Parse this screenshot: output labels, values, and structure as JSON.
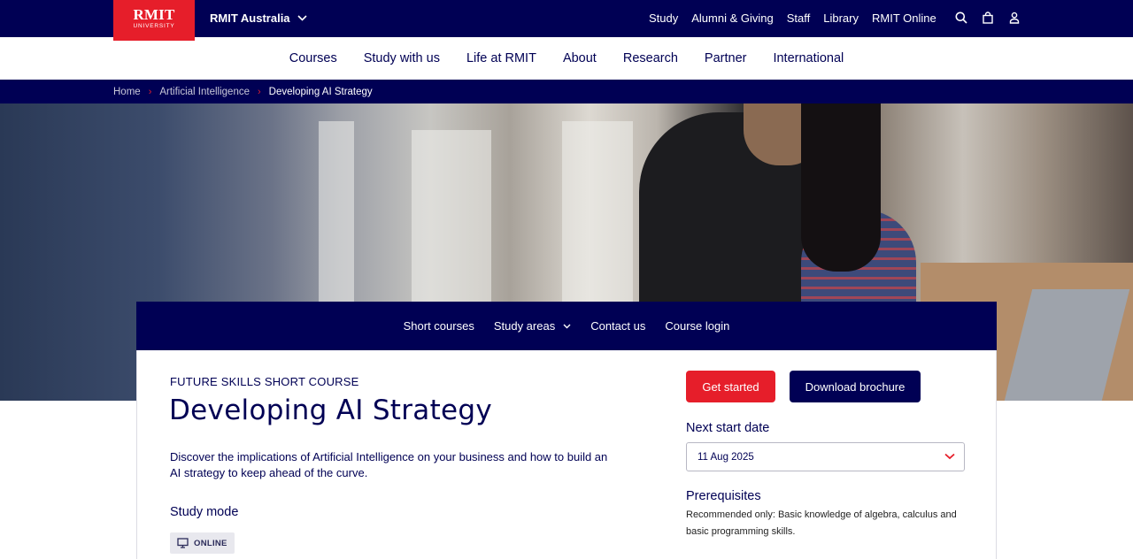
{
  "logo": {
    "mark": "RMIT",
    "sub": "UNIVERSITY"
  },
  "topbar": {
    "site_switch": "RMIT Australia",
    "links": [
      "Study",
      "Alumni & Giving",
      "Staff",
      "Library",
      "RMIT Online"
    ]
  },
  "mainnav": [
    "Courses",
    "Study with us",
    "Life at RMIT",
    "About",
    "Research",
    "Partner",
    "International"
  ],
  "breadcrumb": {
    "home": "Home",
    "parent": "Artificial Intelligence",
    "current": "Developing AI Strategy"
  },
  "subnav": {
    "short_courses": "Short courses",
    "study_areas": "Study areas",
    "contact": "Contact us",
    "login": "Course login"
  },
  "course": {
    "eyebrow": "FUTURE SKILLS SHORT COURSE",
    "title": "Developing AI Strategy",
    "description": "Discover the implications of Artificial Intelligence on your business and how to build an AI strategy to keep ahead of the curve.",
    "study_mode_heading": "Study mode",
    "study_mode_badge": "ONLINE"
  },
  "actions": {
    "get_started": "Get started",
    "download_brochure": "Download brochure"
  },
  "start": {
    "heading": "Next start date",
    "selected": "11 Aug 2025"
  },
  "prerequisites": {
    "heading": "Prerequisites",
    "text": "Recommended only: Basic knowledge of algebra, calculus and basic programming skills."
  },
  "colors": {
    "navy": "#000054",
    "red": "#e61e2a"
  },
  "icons": [
    "chevron-down-icon",
    "search-icon",
    "bag-icon",
    "user-icon",
    "chevron-right-icon",
    "monitor-icon"
  ]
}
